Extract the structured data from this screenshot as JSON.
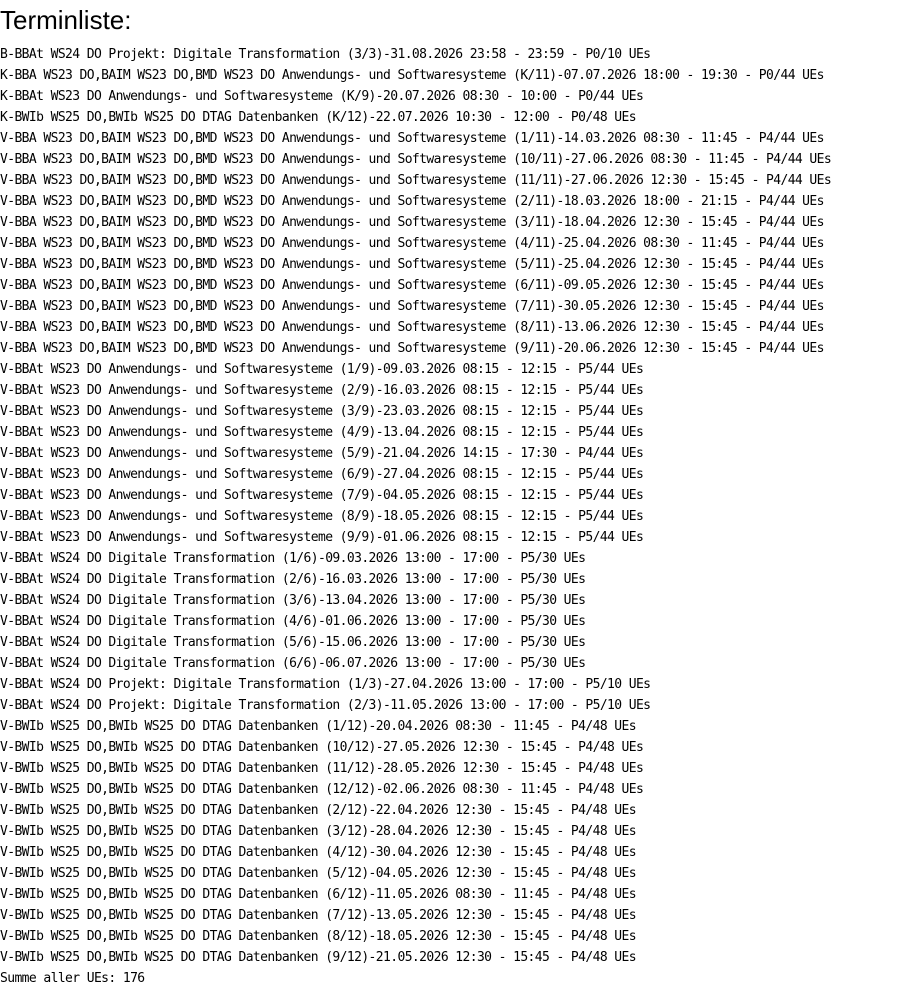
{
  "title": "Terminliste:",
  "entries": [
    "B-BBAt WS24 DO Projekt: Digitale Transformation (3/3)-31.08.2026 23:58 - 23:59 - P0/10 UEs",
    "K-BBA WS23 DO,BAIM WS23 DO,BMD WS23 DO Anwendungs- und Softwaresysteme (K/11)-07.07.2026 18:00 - 19:30 - P0/44 UEs",
    "K-BBAt WS23 DO Anwendungs- und Softwaresysteme (K/9)-20.07.2026 08:30 - 10:00 - P0/44 UEs",
    "K-BWIb WS25 DO,BWIb WS25 DO DTAG Datenbanken (K/12)-22.07.2026 10:30 - 12:00 - P0/48 UEs",
    "V-BBA WS23 DO,BAIM WS23 DO,BMD WS23 DO Anwendungs- und Softwaresysteme (1/11)-14.03.2026 08:30 - 11:45 - P4/44 UEs",
    "V-BBA WS23 DO,BAIM WS23 DO,BMD WS23 DO Anwendungs- und Softwaresysteme (10/11)-27.06.2026 08:30 - 11:45 - P4/44 UEs",
    "V-BBA WS23 DO,BAIM WS23 DO,BMD WS23 DO Anwendungs- und Softwaresysteme (11/11)-27.06.2026 12:30 - 15:45 - P4/44 UEs",
    "V-BBA WS23 DO,BAIM WS23 DO,BMD WS23 DO Anwendungs- und Softwaresysteme (2/11)-18.03.2026 18:00 - 21:15 - P4/44 UEs",
    "V-BBA WS23 DO,BAIM WS23 DO,BMD WS23 DO Anwendungs- und Softwaresysteme (3/11)-18.04.2026 12:30 - 15:45 - P4/44 UEs",
    "V-BBA WS23 DO,BAIM WS23 DO,BMD WS23 DO Anwendungs- und Softwaresysteme (4/11)-25.04.2026 08:30 - 11:45 - P4/44 UEs",
    "V-BBA WS23 DO,BAIM WS23 DO,BMD WS23 DO Anwendungs- und Softwaresysteme (5/11)-25.04.2026 12:30 - 15:45 - P4/44 UEs",
    "V-BBA WS23 DO,BAIM WS23 DO,BMD WS23 DO Anwendungs- und Softwaresysteme (6/11)-09.05.2026 12:30 - 15:45 - P4/44 UEs",
    "V-BBA WS23 DO,BAIM WS23 DO,BMD WS23 DO Anwendungs- und Softwaresysteme (7/11)-30.05.2026 12:30 - 15:45 - P4/44 UEs",
    "V-BBA WS23 DO,BAIM WS23 DO,BMD WS23 DO Anwendungs- und Softwaresysteme (8/11)-13.06.2026 12:30 - 15:45 - P4/44 UEs",
    "V-BBA WS23 DO,BAIM WS23 DO,BMD WS23 DO Anwendungs- und Softwaresysteme (9/11)-20.06.2026 12:30 - 15:45 - P4/44 UEs",
    "V-BBAt WS23 DO Anwendungs- und Softwaresysteme (1/9)-09.03.2026 08:15 - 12:15 - P5/44 UEs",
    "V-BBAt WS23 DO Anwendungs- und Softwaresysteme (2/9)-16.03.2026 08:15 - 12:15 - P5/44 UEs",
    "V-BBAt WS23 DO Anwendungs- und Softwaresysteme (3/9)-23.03.2026 08:15 - 12:15 - P5/44 UEs",
    "V-BBAt WS23 DO Anwendungs- und Softwaresysteme (4/9)-13.04.2026 08:15 - 12:15 - P5/44 UEs",
    "V-BBAt WS23 DO Anwendungs- und Softwaresysteme (5/9)-21.04.2026 14:15 - 17:30 - P4/44 UEs",
    "V-BBAt WS23 DO Anwendungs- und Softwaresysteme (6/9)-27.04.2026 08:15 - 12:15 - P5/44 UEs",
    "V-BBAt WS23 DO Anwendungs- und Softwaresysteme (7/9)-04.05.2026 08:15 - 12:15 - P5/44 UEs",
    "V-BBAt WS23 DO Anwendungs- und Softwaresysteme (8/9)-18.05.2026 08:15 - 12:15 - P5/44 UEs",
    "V-BBAt WS23 DO Anwendungs- und Softwaresysteme (9/9)-01.06.2026 08:15 - 12:15 - P5/44 UEs",
    "V-BBAt WS24 DO Digitale Transformation (1/6)-09.03.2026 13:00 - 17:00 - P5/30 UEs",
    "V-BBAt WS24 DO Digitale Transformation (2/6)-16.03.2026 13:00 - 17:00 - P5/30 UEs",
    "V-BBAt WS24 DO Digitale Transformation (3/6)-13.04.2026 13:00 - 17:00 - P5/30 UEs",
    "V-BBAt WS24 DO Digitale Transformation (4/6)-01.06.2026 13:00 - 17:00 - P5/30 UEs",
    "V-BBAt WS24 DO Digitale Transformation (5/6)-15.06.2026 13:00 - 17:00 - P5/30 UEs",
    "V-BBAt WS24 DO Digitale Transformation (6/6)-06.07.2026 13:00 - 17:00 - P5/30 UEs",
    "V-BBAt WS24 DO Projekt: Digitale Transformation (1/3)-27.04.2026 13:00 - 17:00 - P5/10 UEs",
    "V-BBAt WS24 DO Projekt: Digitale Transformation (2/3)-11.05.2026 13:00 - 17:00 - P5/10 UEs",
    "V-BWIb WS25 DO,BWIb WS25 DO DTAG Datenbanken (1/12)-20.04.2026 08:30 - 11:45 - P4/48 UEs",
    "V-BWIb WS25 DO,BWIb WS25 DO DTAG Datenbanken (10/12)-27.05.2026 12:30 - 15:45 - P4/48 UEs",
    "V-BWIb WS25 DO,BWIb WS25 DO DTAG Datenbanken (11/12)-28.05.2026 12:30 - 15:45 - P4/48 UEs",
    "V-BWIb WS25 DO,BWIb WS25 DO DTAG Datenbanken (12/12)-02.06.2026 08:30 - 11:45 - P4/48 UEs",
    "V-BWIb WS25 DO,BWIb WS25 DO DTAG Datenbanken (2/12)-22.04.2026 12:30 - 15:45 - P4/48 UEs",
    "V-BWIb WS25 DO,BWIb WS25 DO DTAG Datenbanken (3/12)-28.04.2026 12:30 - 15:45 - P4/48 UEs",
    "V-BWIb WS25 DO,BWIb WS25 DO DTAG Datenbanken (4/12)-30.04.2026 12:30 - 15:45 - P4/48 UEs",
    "V-BWIb WS25 DO,BWIb WS25 DO DTAG Datenbanken (5/12)-04.05.2026 12:30 - 15:45 - P4/48 UEs",
    "V-BWIb WS25 DO,BWIb WS25 DO DTAG Datenbanken (6/12)-11.05.2026 08:30 - 11:45 - P4/48 UEs",
    "V-BWIb WS25 DO,BWIb WS25 DO DTAG Datenbanken (7/12)-13.05.2026 12:30 - 15:45 - P4/48 UEs",
    "V-BWIb WS25 DO,BWIb WS25 DO DTAG Datenbanken (8/12)-18.05.2026 12:30 - 15:45 - P4/48 UEs",
    "V-BWIb WS25 DO,BWIb WS25 DO DTAG Datenbanken (9/12)-21.05.2026 12:30 - 15:45 - P4/48 UEs"
  ],
  "summary": "Summe aller UEs: 176"
}
